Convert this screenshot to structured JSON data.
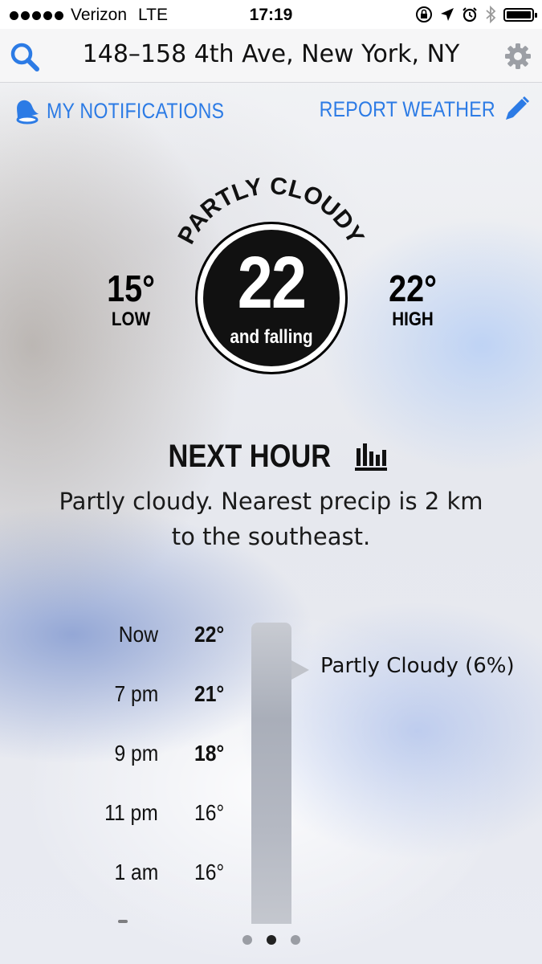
{
  "status_bar": {
    "signal_dots": 5,
    "carrier": "Verizon",
    "network": "LTE",
    "time": "17:19",
    "icons": [
      "rotation-lock-icon",
      "location-arrow-icon",
      "alarm-icon",
      "bluetooth-icon",
      "battery-icon"
    ],
    "battery_level": 0.9
  },
  "header": {
    "search_icon": "search-icon",
    "location": "148–158 4th Ave, New York, NY",
    "settings_icon": "gear-icon"
  },
  "actions": {
    "notifications_label": "MY NOTIFICATIONS",
    "notifications_icon": "bell-icon",
    "report_label": "REPORT WEATHER",
    "report_icon": "pencil-icon"
  },
  "current": {
    "condition": "PARTLY CLOUDY",
    "temp": "22",
    "trend": "and falling",
    "low_value": "15°",
    "low_label": "LOW",
    "high_value": "22°",
    "high_label": "HIGH"
  },
  "next_hour": {
    "title": "NEXT HOUR",
    "chart_icon": "bar-chart-icon",
    "description": "Partly cloudy. Nearest precip is 2 km to the southeast."
  },
  "hourly": [
    {
      "time": "Now",
      "temp": "22°"
    },
    {
      "time": "7 pm",
      "temp": "21°"
    },
    {
      "time": "9 pm",
      "temp": "18°"
    },
    {
      "time": "11 pm",
      "temp": "16°"
    },
    {
      "time": "1 am",
      "temp": "16°"
    }
  ],
  "forecast_label": "Partly Cloudy (6%)",
  "pager": {
    "pages": 3,
    "active": 2
  },
  "colors": {
    "accent": "#2c7be5",
    "dial": "#111111",
    "track": "#b5b9c3"
  }
}
